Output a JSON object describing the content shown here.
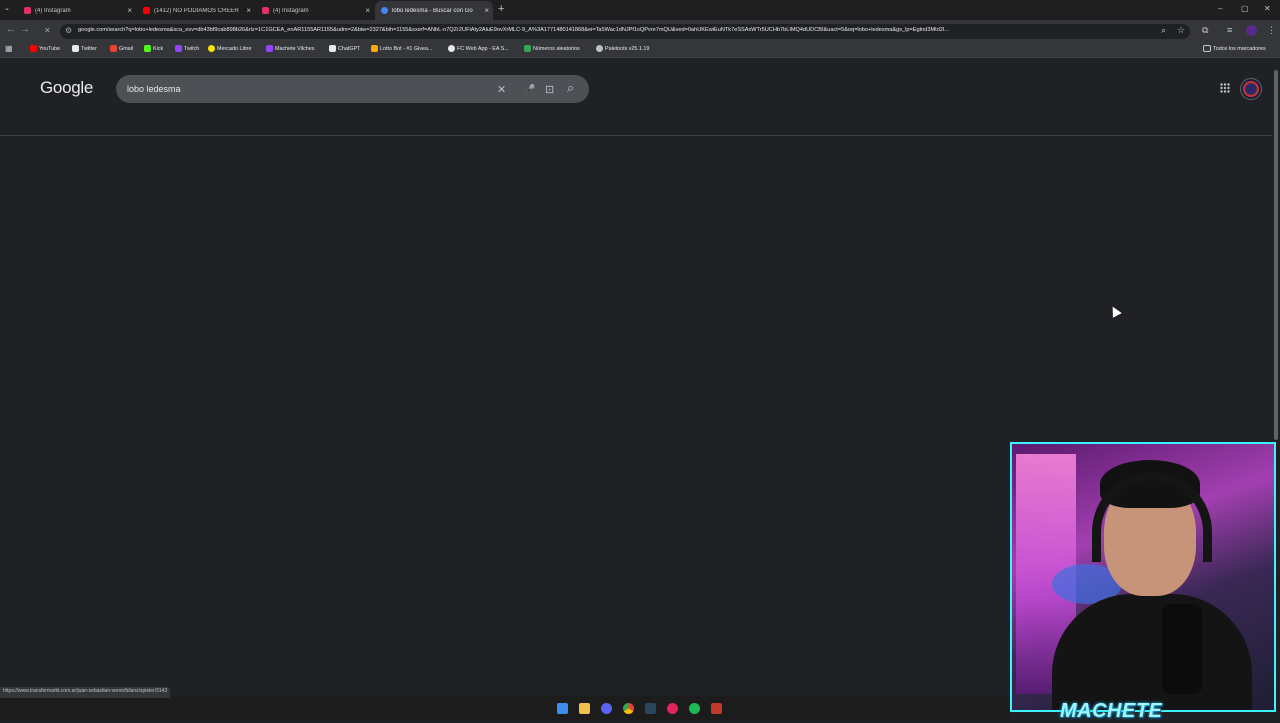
{
  "tabs": [
    {
      "title": "(4) Instagram",
      "favicon_color": "#e1306c",
      "active": false
    },
    {
      "title": "(1412) NO PODÍAMOS CREER",
      "favicon_color": "#ff0000",
      "active": false
    },
    {
      "title": "(4) Instagram",
      "favicon_color": "#e1306c",
      "active": false
    },
    {
      "title": "lobo ledesma - Buscar con Go",
      "favicon_color": "#4285f4",
      "active": true
    }
  ],
  "tab_close": "×",
  "new_tab": "+",
  "window_controls": {
    "minimize": "–",
    "maximize": "▢",
    "close": "✕"
  },
  "nav": {
    "back": "←",
    "forward": "→",
    "stop": "✕"
  },
  "address_bar": {
    "url": "google.com/search?q=lobo+ledesma&sca_esv=db43bf9cab898b26&rlz=1C1GCEA_enAR1155AR1155&udm=2&biw=2327&bih=1155&sxsrf=ANbL-n7QZr2UFiAty2AluE9ovXrMLC-9_A%3A1771480141868&ei=Ta5Wac1dNJPf1sQPvre7mQU&ved=0ahUKEwiEuNTk7eSSAxWTr5UCHb7bLIMQ4dUDCBI&uact=5&oq=lobo+ledesma&gs_lp=Egtnd3Mtd2l..."
  },
  "bookmarks": [
    {
      "label": "YouTube",
      "color": "#ff0000"
    },
    {
      "label": "Twitter",
      "color": "#e8eaed"
    },
    {
      "label": "Gmail",
      "color": "#ea4335"
    },
    {
      "label": "Kick",
      "color": "#53fc18"
    },
    {
      "label": "Twitch",
      "color": "#9146ff"
    },
    {
      "label": "Mercado Libre",
      "color": "#ffe600"
    },
    {
      "label": "Machete Vilches",
      "color": "#9146ff"
    },
    {
      "label": "ChatGPT",
      "color": "#e8eaed"
    },
    {
      "label": "Lotto Bot - #1 Givea...",
      "color": "#f9ab00"
    },
    {
      "label": "FC Web App - EA S...",
      "color": "#e8eaed"
    },
    {
      "label": "Números aleatorios",
      "color": "#34a853"
    },
    {
      "label": "Paletools v25.1.19",
      "color": "#bdc1c6"
    }
  ],
  "bookmarks_all": "Todos los marcadores",
  "google": {
    "logo": "Google",
    "query": "lobo ledesma",
    "clear_icon": "✕",
    "mic_icon": "🎤",
    "lens_icon": "⊡",
    "search_icon": "⌕",
    "apps_icon": "⋮⋮⋮"
  },
  "status_url": "https://www.transfermarkt.com.ar/juan-sebastian-veron/bilanz/spieler/3143",
  "webcam_name": "MACHETE",
  "colors": {
    "background": "#202124",
    "accent_cam": "#3cf3ff"
  }
}
